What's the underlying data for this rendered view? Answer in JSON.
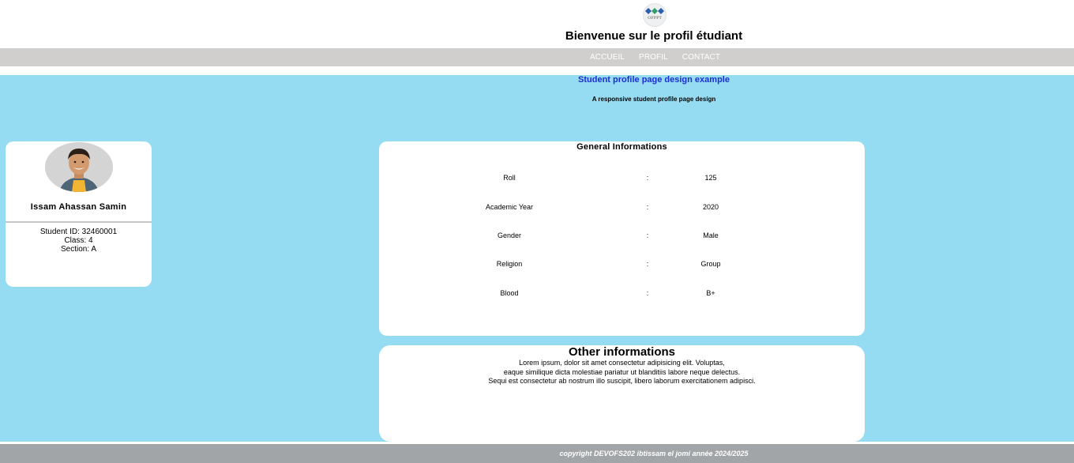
{
  "header": {
    "logo_icon": "ofppt-logo-icon",
    "logo_text": "OFPPT",
    "title": "Bienvenue sur le profil étudiant"
  },
  "nav": {
    "items": [
      {
        "label": "ACCUEIL"
      },
      {
        "label": "PROFIL"
      },
      {
        "label": "CONTACT"
      }
    ]
  },
  "main": {
    "subtitle": "Student profile page design example",
    "tagline": "A responsive student profile page design"
  },
  "profile": {
    "avatar_icon": "student-avatar-icon",
    "name": "Issam Ahassan Samin",
    "student_id": "Student ID: 32460001",
    "class": "Class: 4",
    "section": "Section: A"
  },
  "general": {
    "title": "General Informations",
    "separator": ":",
    "rows": [
      {
        "label": "Roll",
        "value": "125"
      },
      {
        "label": "Academic Year",
        "value": "2020"
      },
      {
        "label": "Gender",
        "value": "Male"
      },
      {
        "label": "Religion",
        "value": "Group"
      },
      {
        "label": "Blood",
        "value": "B+"
      }
    ]
  },
  "other": {
    "title": "Other informations",
    "lines": [
      "Lorem ipsum, dolor sit amet consectetur adipisicing elit. Voluptas,",
      "eaque similique dicta molestiae pariatur ut blanditiis labore neque delectus.",
      "Sequi est consectetur ab nostrum illo suscipit, libero laborum exercitationem adipisci."
    ]
  },
  "footer": {
    "text": "copyright DEVOFS202 ibtissam el jomi année 2024/2025"
  },
  "colors": {
    "main_bg": "#95dcf2",
    "nav_bg": "#d0cfcd",
    "footer_bg": "#a2a5a8",
    "subtitle": "#1a2fd1"
  }
}
